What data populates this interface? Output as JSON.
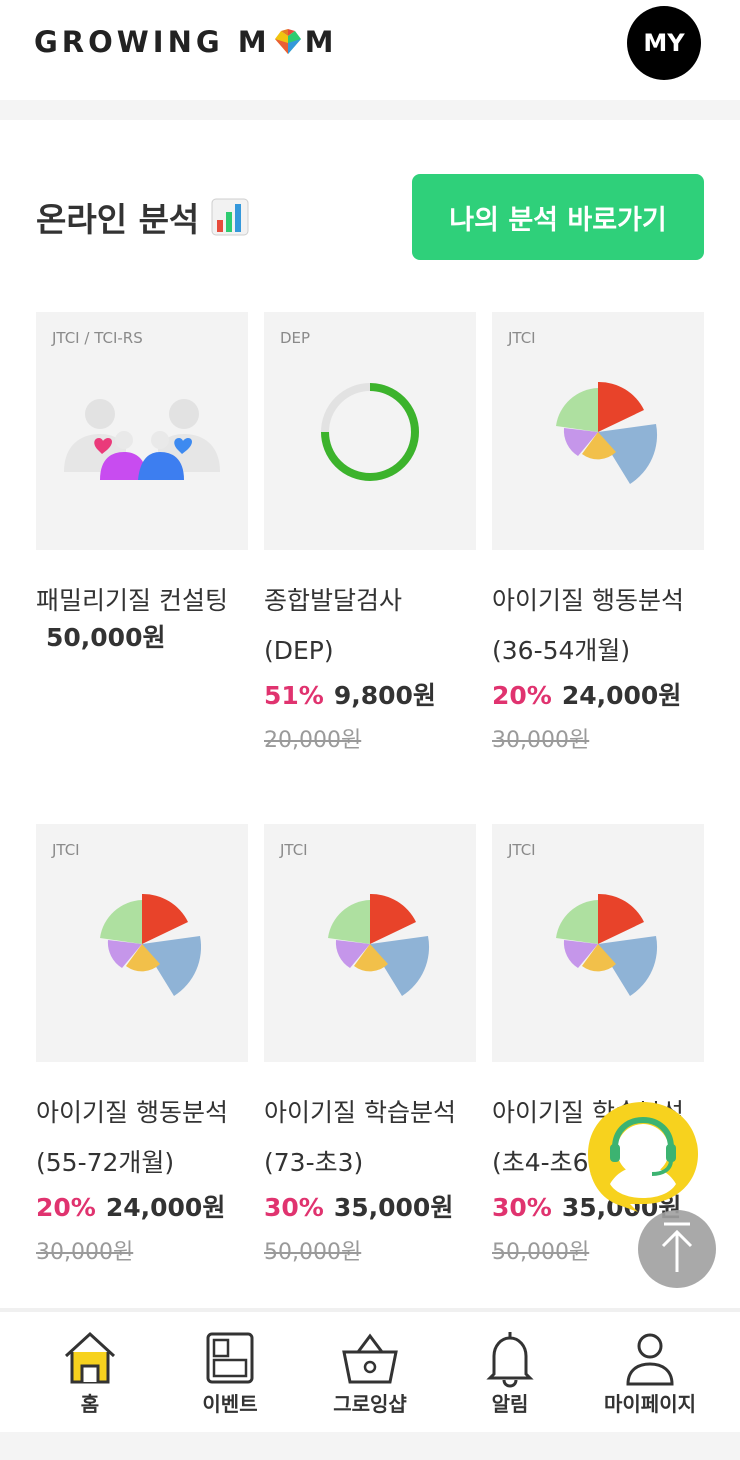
{
  "header": {
    "logo_text_before": "GROWING M",
    "logo_text_after": "M",
    "my_label": "MY"
  },
  "section": {
    "title": "온라인 분석",
    "cta_label": "나의 분석 바로가기"
  },
  "colors": {
    "accent_green": "#2fd07a",
    "discount_pink": "#e0336f",
    "logo_heart": [
      "#f1c40f",
      "#e74c3c",
      "#2ecc71",
      "#3498db"
    ]
  },
  "products": [
    {
      "tag": "JTCI / TCI-RS",
      "art": "family-icon",
      "name1": "패밀리기질 컨설팅",
      "name2": "",
      "discount": "",
      "price": "50,000원",
      "original": ""
    },
    {
      "tag": "DEP",
      "art": "progress-ring-icon",
      "name1": "종합발달검사",
      "name2": "(DEP)",
      "discount": "51%",
      "price": "9,800원",
      "original": "20,000원"
    },
    {
      "tag": "JTCI",
      "art": "pie-chart-icon",
      "name1": "아이기질 행동분석",
      "name2": "(36-54개월)",
      "discount": "20%",
      "price": "24,000원",
      "original": "30,000원"
    },
    {
      "tag": "JTCI",
      "art": "pie-chart-icon",
      "name1": "아이기질 행동분석",
      "name2": "(55-72개월)",
      "discount": "20%",
      "price": "24,000원",
      "original": "30,000원"
    },
    {
      "tag": "JTCI",
      "art": "pie-chart-icon",
      "name1": "아이기질 학습분석",
      "name2": "(73-초3)",
      "discount": "30%",
      "price": "35,000원",
      "original": "50,000원"
    },
    {
      "tag": "JTCI",
      "art": "pie-chart-icon",
      "name1": "아이기질 학습분석",
      "name2": "(초4-초6)",
      "discount": "30%",
      "price": "35,000원",
      "original": "50,000원"
    }
  ],
  "nav": [
    {
      "label": "홈",
      "icon": "home-icon"
    },
    {
      "label": "이벤트",
      "icon": "event-icon"
    },
    {
      "label": "그로잉샵",
      "icon": "shop-basket-icon"
    },
    {
      "label": "알림",
      "icon": "bell-icon"
    },
    {
      "label": "마이페이지",
      "icon": "person-icon"
    }
  ]
}
